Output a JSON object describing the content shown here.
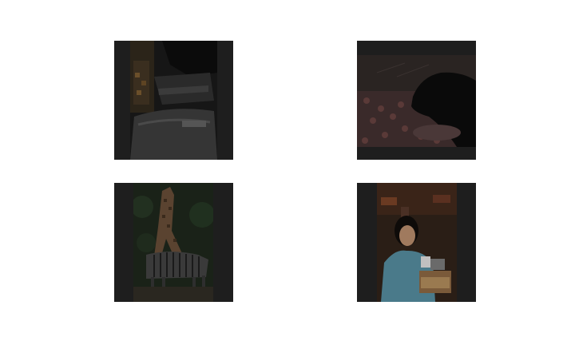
{
  "figure": {
    "background": "#ffffff",
    "tiles": [
      {
        "id": 1,
        "subject": "dark-interior-scene",
        "frame_color": "#222222"
      },
      {
        "id": 2,
        "subject": "dark-dog-on-bed",
        "frame_color": "#222222"
      },
      {
        "id": 3,
        "subject": "giraffe-and-zebras",
        "frame_color": "#222222"
      },
      {
        "id": 4,
        "subject": "child-eating-at-restaurant",
        "frame_color": "#222222"
      }
    ]
  }
}
